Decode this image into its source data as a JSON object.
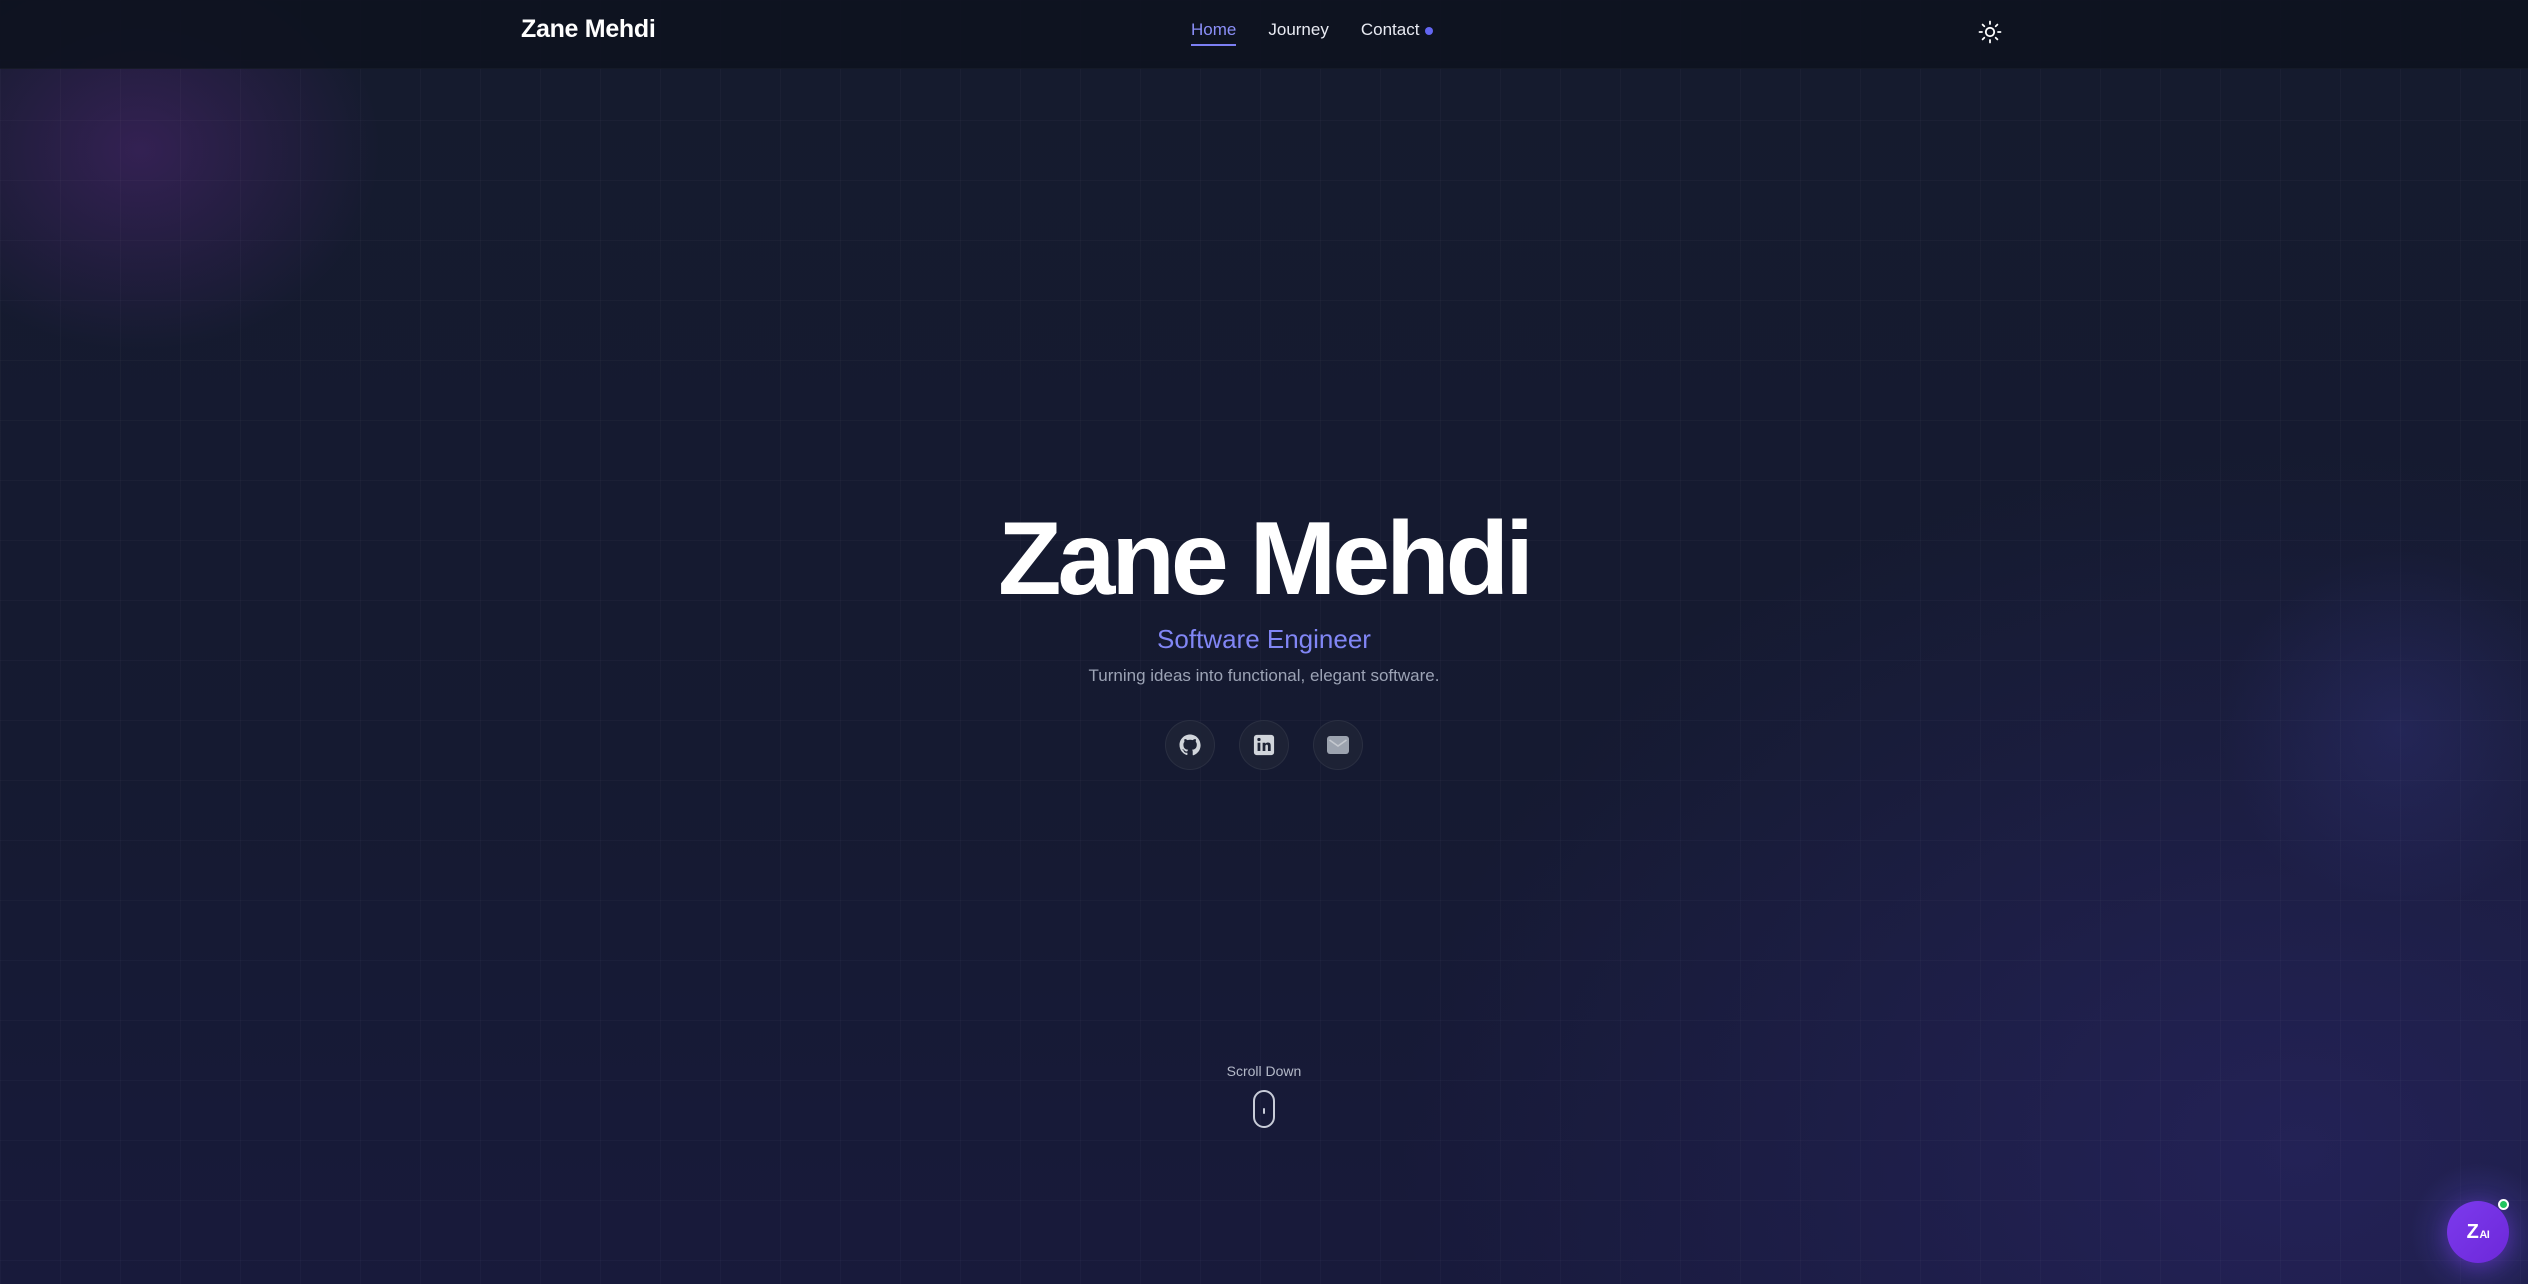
{
  "brand": "Zane Mehdi",
  "nav": {
    "items": [
      {
        "label": "Home",
        "active": true
      },
      {
        "label": "Journey",
        "active": false
      },
      {
        "label": "Contact",
        "active": false
      }
    ],
    "contact_indicator_color": "#6366f1"
  },
  "theme_toggle": {
    "icon": "sun-icon"
  },
  "hero": {
    "name": "Zane Mehdi",
    "role": "Software Engineer",
    "tagline": "Turning ideas into functional, elegant software."
  },
  "socials": [
    {
      "icon": "github-icon"
    },
    {
      "icon": "linkedin-icon"
    },
    {
      "icon": "email-icon"
    }
  ],
  "scroll_hint": {
    "label": "Scroll Down",
    "icon": "mouse-icon"
  },
  "ai_assistant": {
    "label_main": "Z",
    "label_sub": "AI",
    "status_color": "#22c55e"
  },
  "colors": {
    "accent": "#8186f5",
    "background": "#141a2e"
  }
}
